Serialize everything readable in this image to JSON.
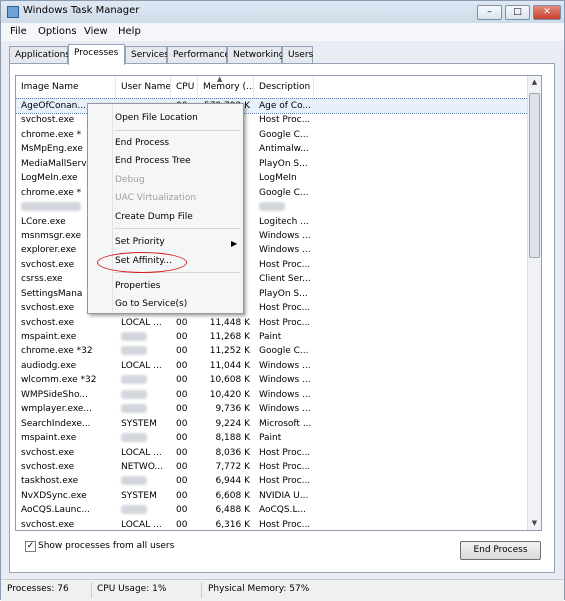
{
  "window": {
    "title": "Windows Task Manager",
    "minimize_symbol": "–",
    "maximize_symbol": "□",
    "close_symbol": "✕"
  },
  "menu": [
    "File",
    "Options",
    "View",
    "Help"
  ],
  "tabs": [
    "Applications",
    "Processes",
    "Services",
    "Performance",
    "Networking",
    "Users"
  ],
  "active_tab": "Processes",
  "columns": [
    "Image Name",
    "User Name",
    "CPU",
    "Memory (...",
    "Description"
  ],
  "sort_indicator": "▲",
  "rows": [
    {
      "name": "AgeOfConan...",
      "user": "",
      "cpu": "00",
      "mem": "579,792 K",
      "desc": "Age of Co...",
      "selected": true
    },
    {
      "name": "svchost.exe",
      "user": "",
      "cpu": "",
      "mem": "",
      "desc": "Host Proc..."
    },
    {
      "name": "chrome.exe *",
      "user": "",
      "cpu": "",
      "mem": "",
      "desc": "Google C..."
    },
    {
      "name": "MsMpEng.exe",
      "user": "",
      "cpu": "",
      "mem": "",
      "desc": "Antimalw..."
    },
    {
      "name": "MediaMallServ",
      "user": "",
      "cpu": "",
      "mem": "",
      "desc": "PlayOn S..."
    },
    {
      "name": "LogMeIn.exe",
      "user": "",
      "cpu": "",
      "mem": "",
      "desc": "LogMeIn"
    },
    {
      "name": "chrome.exe *",
      "user": "",
      "cpu": "",
      "mem": "",
      "desc": "Google C..."
    },
    {
      "name": "",
      "user": "",
      "cpu": "",
      "mem": "",
      "desc": "",
      "blurred": true
    },
    {
      "name": "LCore.exe",
      "user": "",
      "cpu": "",
      "mem": "",
      "desc": "Logitech ..."
    },
    {
      "name": "msnmsgr.exe",
      "user": "",
      "cpu": "",
      "mem": "",
      "desc": "Windows ..."
    },
    {
      "name": "explorer.exe",
      "user": "",
      "cpu": "",
      "mem": "",
      "desc": "Windows ..."
    },
    {
      "name": "svchost.exe",
      "user": "",
      "cpu": "",
      "mem": "",
      "desc": "Host Proc..."
    },
    {
      "name": "csrss.exe",
      "user": "",
      "cpu": "",
      "mem": "",
      "desc": "Client Ser..."
    },
    {
      "name": "SettingsMana",
      "user": "",
      "cpu": "",
      "mem": "",
      "desc": "PlayOn S..."
    },
    {
      "name": "svchost.exe",
      "user": "",
      "cpu": "",
      "mem": "",
      "desc": "Host Proc..."
    },
    {
      "name": "svchost.exe",
      "user": "LOCAL ...",
      "cpu": "00",
      "mem": "11,448 K",
      "desc": "Host Proc..."
    },
    {
      "name": "mspaint.exe",
      "user": "",
      "cpu": "00",
      "mem": "11,268 K",
      "desc": "Paint"
    },
    {
      "name": "chrome.exe *32",
      "user": "",
      "cpu": "00",
      "mem": "11,252 K",
      "desc": "Google C..."
    },
    {
      "name": "audiodg.exe",
      "user": "LOCAL ...",
      "cpu": "00",
      "mem": "11,044 K",
      "desc": "Windows ..."
    },
    {
      "name": "wlcomm.exe *32",
      "user": "",
      "cpu": "00",
      "mem": "10,608 K",
      "desc": "Windows ..."
    },
    {
      "name": "WMPSideSho...",
      "user": "",
      "cpu": "00",
      "mem": "10,420 K",
      "desc": "Windows ..."
    },
    {
      "name": "wmplayer.exe...",
      "user": "",
      "cpu": "00",
      "mem": "9,736 K",
      "desc": "Windows ..."
    },
    {
      "name": "SearchIndexe...",
      "user": "SYSTEM",
      "cpu": "00",
      "mem": "9,224 K",
      "desc": "Microsoft ..."
    },
    {
      "name": "mspaint.exe",
      "user": "",
      "cpu": "00",
      "mem": "8,188 K",
      "desc": "Paint"
    },
    {
      "name": "svchost.exe",
      "user": "LOCAL ...",
      "cpu": "00",
      "mem": "8,036 K",
      "desc": "Host Proc..."
    },
    {
      "name": "svchost.exe",
      "user": "NETWO...",
      "cpu": "00",
      "mem": "7,772 K",
      "desc": "Host Proc..."
    },
    {
      "name": "taskhost.exe",
      "user": "",
      "cpu": "00",
      "mem": "6,944 K",
      "desc": "Host Proc..."
    },
    {
      "name": "NvXDSync.exe",
      "user": "SYSTEM",
      "cpu": "00",
      "mem": "6,608 K",
      "desc": "NVIDIA U..."
    },
    {
      "name": "AoCQS.Launc...",
      "user": "",
      "cpu": "00",
      "mem": "6,488 K",
      "desc": "AoCQS.L..."
    },
    {
      "name": "svchost.exe",
      "user": "LOCAL ...",
      "cpu": "00",
      "mem": "6,316 K",
      "desc": "Host Proc..."
    }
  ],
  "context_menu": {
    "items": [
      {
        "label": "Open File Location",
        "disabled": false
      },
      {
        "label": "End Process",
        "disabled": false
      },
      {
        "label": "End Process Tree",
        "disabled": false
      },
      {
        "label": "Debug",
        "disabled": true
      },
      {
        "label": "UAC Virtualization",
        "disabled": true
      },
      {
        "label": "Create Dump File",
        "disabled": false
      },
      {
        "label": "Set Priority",
        "disabled": false,
        "submenu": true
      },
      {
        "label": "Set Affinity...",
        "disabled": false,
        "highlighted": true
      },
      {
        "label": "Properties",
        "disabled": false
      },
      {
        "label": "Go to Service(s)",
        "disabled": false
      }
    ],
    "submenu_arrow": "▶",
    "highlight_color": "#d21f1f"
  },
  "show_all_users": {
    "label": "Show processes from all users",
    "checked": true,
    "check_mark": "✓"
  },
  "end_process_button": "End Process",
  "status": {
    "processes": "Processes: 76",
    "cpu": "CPU Usage: 1%",
    "memory": "Physical Memory: 57%"
  },
  "colors": {
    "selection": "#e7f0fb",
    "title_bar": "#dfe8f3",
    "highlight_ellipse": "#d21f1f"
  }
}
